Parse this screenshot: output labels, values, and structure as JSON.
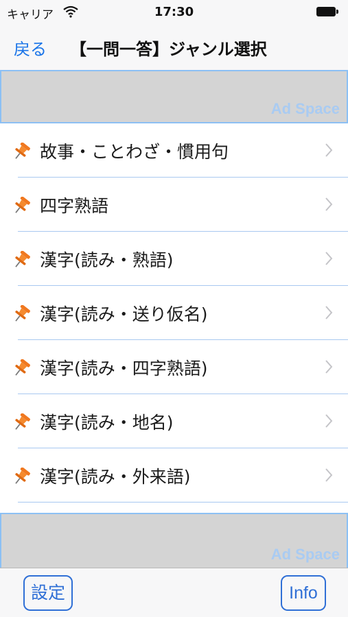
{
  "status_bar": {
    "carrier": "キャリア",
    "time": "17:30"
  },
  "nav": {
    "back_label": "戻る",
    "title": "【一問一答】ジャンル選択"
  },
  "ads": {
    "top_label": "Ad Space",
    "bottom_label": "Ad Space"
  },
  "genres": [
    {
      "label": "故事・ことわざ・慣用句"
    },
    {
      "label": "四字熟語"
    },
    {
      "label": "漢字(読み・熟語)"
    },
    {
      "label": "漢字(読み・送り仮名)"
    },
    {
      "label": "漢字(読み・四字熟語)"
    },
    {
      "label": "漢字(読み・地名)"
    },
    {
      "label": "漢字(読み・外来語)"
    }
  ],
  "toolbar": {
    "settings_label": "設定",
    "info_label": "Info"
  },
  "colors": {
    "accent": "#1a74e8",
    "pin": "#f07820",
    "ad_bg": "#d4d4d4",
    "ad_text": "#a9cbf2",
    "divider": "#a8c8f0"
  }
}
